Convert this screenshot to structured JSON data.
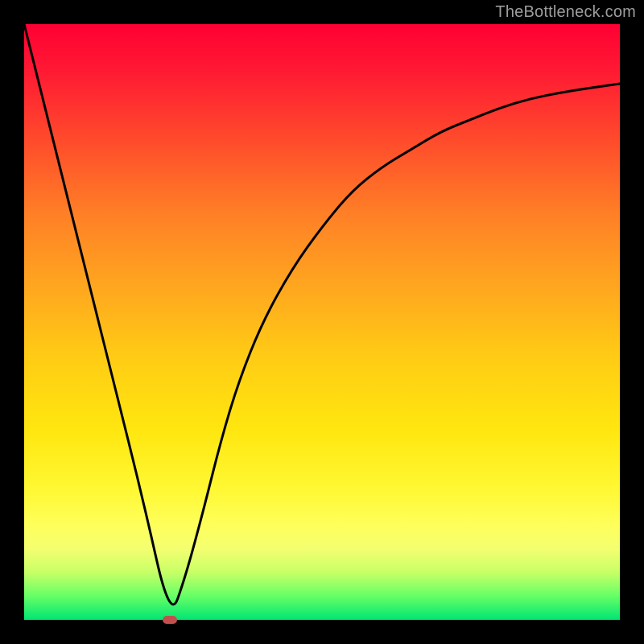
{
  "watermark": "TheBottleneck.com",
  "colors": {
    "frame": "#000000",
    "curve": "#000000",
    "min_marker": "#c0504d",
    "gradient_top": "#ff0033",
    "gradient_bottom": "#00e573"
  },
  "chart_data": {
    "type": "line",
    "title": "",
    "xlabel": "",
    "ylabel": "",
    "xlim": [
      0,
      100
    ],
    "ylim": [
      0,
      100
    ],
    "grid": false,
    "legend": false,
    "series": [
      {
        "name": "bottleneck-curve",
        "x": [
          0,
          5,
          10,
          15,
          20,
          24.5,
          27,
          30,
          33,
          36,
          40,
          45,
          50,
          55,
          60,
          65,
          70,
          75,
          80,
          85,
          90,
          95,
          100
        ],
        "y": [
          100,
          80,
          60,
          40,
          20,
          0,
          7,
          18,
          30,
          40,
          50,
          59,
          66,
          72,
          76,
          79,
          82,
          84,
          86,
          87.5,
          88.5,
          89.3,
          90
        ]
      }
    ],
    "annotations": [
      {
        "name": "minimum",
        "x": 24.5,
        "y": 0
      }
    ]
  }
}
